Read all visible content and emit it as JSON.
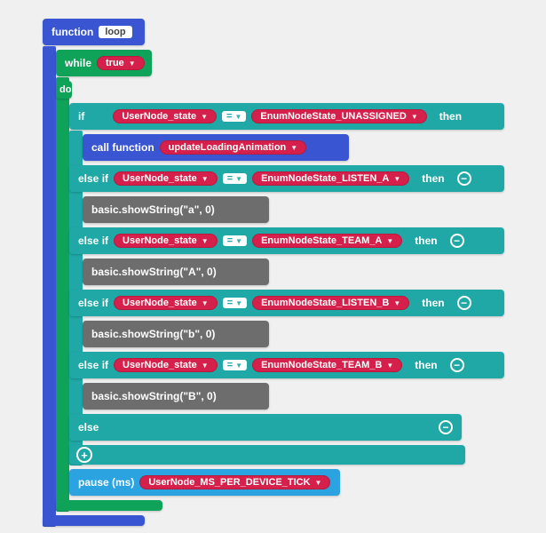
{
  "func": {
    "keyword": "function",
    "name": "loop"
  },
  "while": {
    "keyword": "while",
    "cond": "true"
  },
  "do": "do",
  "if": {
    "kw": "if",
    "var": "UserNode_state",
    "op": "=",
    "val": "EnumNodeState_UNASSIGNED",
    "then": "then"
  },
  "call": {
    "kw": "call function",
    "fn": "updateLoadingAnimation"
  },
  "branch1": {
    "kw": "else if",
    "var": "UserNode_state",
    "op": "=",
    "val": "EnumNodeState_LISTEN_A",
    "then": "then",
    "body": "basic.showString(\"a\", 0)"
  },
  "branch2": {
    "kw": "else if",
    "var": "UserNode_state",
    "op": "=",
    "val": "EnumNodeState_TEAM_A",
    "then": "then",
    "body": "basic.showString(\"A\", 0)"
  },
  "branch3": {
    "kw": "else if",
    "var": "UserNode_state",
    "op": "=",
    "val": "EnumNodeState_LISTEN_B",
    "then": "then",
    "body": "basic.showString(\"b\", 0)"
  },
  "branch4": {
    "kw": "else if",
    "var": "UserNode_state",
    "op": "=",
    "val": "EnumNodeState_TEAM_B",
    "then": "then",
    "body": "basic.showString(\"B\", 0)"
  },
  "else": "else",
  "pause": {
    "kw": "pause (ms)",
    "var": "UserNode_MS_PER_DEVICE_TICK"
  }
}
